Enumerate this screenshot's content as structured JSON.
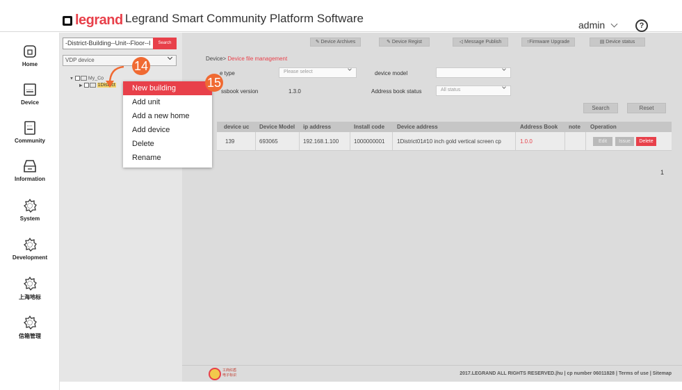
{
  "header": {
    "logo_text": "legrand",
    "title": "Legrand Smart Community Platform Software",
    "user": "admin",
    "help_symbol": "?"
  },
  "nav": {
    "items": [
      {
        "label": "Home",
        "icon": "home-icon"
      },
      {
        "label": "Device",
        "icon": "device-icon"
      },
      {
        "label": "Community",
        "icon": "community-icon"
      },
      {
        "label": "Information",
        "icon": "information-icon"
      },
      {
        "label": "System",
        "icon": "gear-icon"
      },
      {
        "label": "Development",
        "icon": "gear-icon"
      },
      {
        "label": "上海地标",
        "icon": "gear-icon"
      },
      {
        "label": "信箱管理",
        "icon": "gear-icon"
      }
    ]
  },
  "tree": {
    "search_value": "-District-Building--Unit--Floor--I",
    "search_button": "Search",
    "select_value": "VDP device",
    "root_label": "My_Co",
    "district_label": "1District"
  },
  "callouts": {
    "step1": "14",
    "step2": "15"
  },
  "context_menu": {
    "items": [
      "New building",
      "Add unit",
      "Add a new home",
      "Add device",
      "Delete",
      "Rename"
    ]
  },
  "toolbar": {
    "device_archives": "Device Archives",
    "device_regist": "Device Regist",
    "message_publish": "Message Publish",
    "firmware_upgrade": "Firmware Upgrade",
    "device_status": "Device status"
  },
  "breadcrumb": {
    "parent": "Device",
    "current": "Device file management"
  },
  "filters": {
    "device_type_label": "e type",
    "device_type_value": "Please select",
    "device_model_label": "device model",
    "device_model_value": "",
    "addressbook_label": "ssbook version",
    "addressbook_value": "1.3.0",
    "address_book_status_label": "Address book status",
    "address_book_status_value": "All status",
    "search_button": "Search",
    "reset_button": "Reset"
  },
  "table": {
    "headers": [
      "device uc",
      "Device Model",
      "ip address",
      "Install code",
      "Device address",
      "Address Book",
      "note",
      "Operation"
    ],
    "rows": [
      {
        "device_uc": "139",
        "model": "693065",
        "ip": "192.168.1.100",
        "install_code": "1000000001",
        "address": "1District01#10 inch gold vertical screen cp",
        "address_book": "1.0.0",
        "note": ""
      }
    ],
    "actions": {
      "edit": "Edit",
      "issue": "Issue",
      "delete": "Delete"
    }
  },
  "pagination": {
    "page": "1"
  },
  "footer": {
    "text": "2017.LEGRAND ALL RIGHTS RESERVED.|hu | cp number 06011828 | Terms of use | Sitemap",
    "seal_line1": "工商红盾",
    "seal_line2": "电子标识"
  },
  "colors": {
    "accent": "#e8404a",
    "callout": "#f06a32"
  }
}
